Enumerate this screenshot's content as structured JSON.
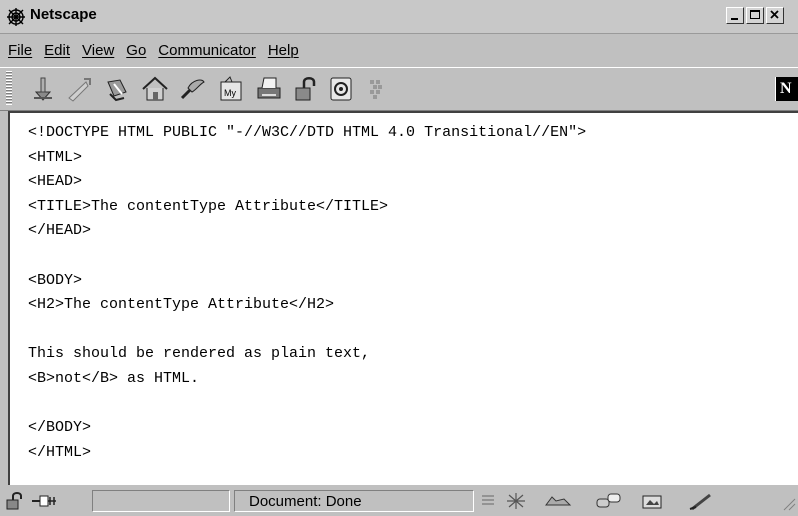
{
  "window": {
    "title": "Netscape"
  },
  "menu": {
    "items": [
      "File",
      "Edit",
      "View",
      "Go",
      "Communicator",
      "Help"
    ]
  },
  "toolbar": {
    "icons": [
      "back-icon",
      "forward-icon",
      "reload-icon",
      "home-icon",
      "search-icon",
      "my-netscape-icon",
      "print-icon",
      "security-icon",
      "shop-icon",
      "stop-icon"
    ],
    "logo_letter": "N"
  },
  "content": {
    "lines": [
      "<!DOCTYPE HTML PUBLIC \"-//W3C//DTD HTML 4.0 Transitional//EN\">",
      "<HTML>",
      "<HEAD>",
      "<TITLE>The contentType Attribute</TITLE>",
      "</HEAD>",
      "",
      "<BODY>",
      "<H2>The contentType Attribute</H2>",
      "",
      "This should be rendered as plain text,",
      "<B>not</B> as HTML.",
      "",
      "</BODY>",
      "</HTML>"
    ]
  },
  "statusbar": {
    "status_text": "Document: Done"
  }
}
